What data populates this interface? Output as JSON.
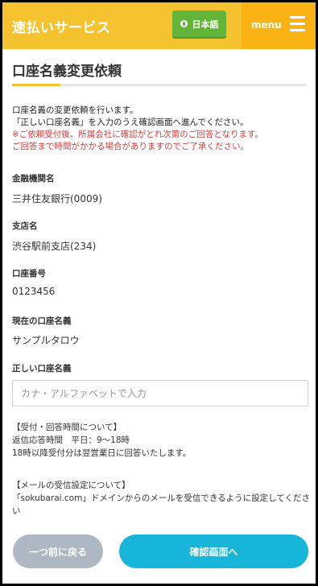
{
  "header": {
    "brand": "速払いサービス",
    "language_button": "日本語",
    "menu_label": "menu"
  },
  "page": {
    "title": "口座名義変更依頼"
  },
  "intro": {
    "line1": "口座名義の変更依頼を行います。",
    "line2": "「正しい口座名義」を入力のうえ確認画面へ進んでください。",
    "notice1": "※ご依頼受付後、所属会社に確認がとれ次第のご回答となります。",
    "notice2": "ご回答まで時間がかかる場合がありますのでご了承ください。"
  },
  "fields": {
    "bank": {
      "label": "金融機関名",
      "value": "三井住友銀行(0009)"
    },
    "branch": {
      "label": "支店名",
      "value": "渋谷駅前支店(234)"
    },
    "account_number": {
      "label": "口座番号",
      "value": "0123456"
    },
    "current_name": {
      "label": "現在の口座名義",
      "value": "サンプルタロウ"
    },
    "correct_name": {
      "label": "正しい口座名義",
      "placeholder": "カナ・アルファベットで入力",
      "value": ""
    }
  },
  "info": {
    "reception_heading": "【受付・回答時間について】",
    "reception_line1": "返信応答時間　平日：9〜18時",
    "reception_line2": "18時以降受付分は翌営業日に回答いたします。",
    "mail_heading": "【メールの受信設定について】",
    "mail_line1": "「sokubarai.com」ドメインからのメールを受信できるように設定してくださ",
    "mail_line2": "い"
  },
  "buttons": {
    "back": "一つ前に戻る",
    "confirm": "確認画面へ"
  },
  "colors": {
    "header": "#f5c32f",
    "menu": "#fbb314",
    "language_button": "#63b53a",
    "notice_text": "#e23b3b",
    "back_button": "#adb8c2",
    "confirm_button": "#18b5db"
  }
}
